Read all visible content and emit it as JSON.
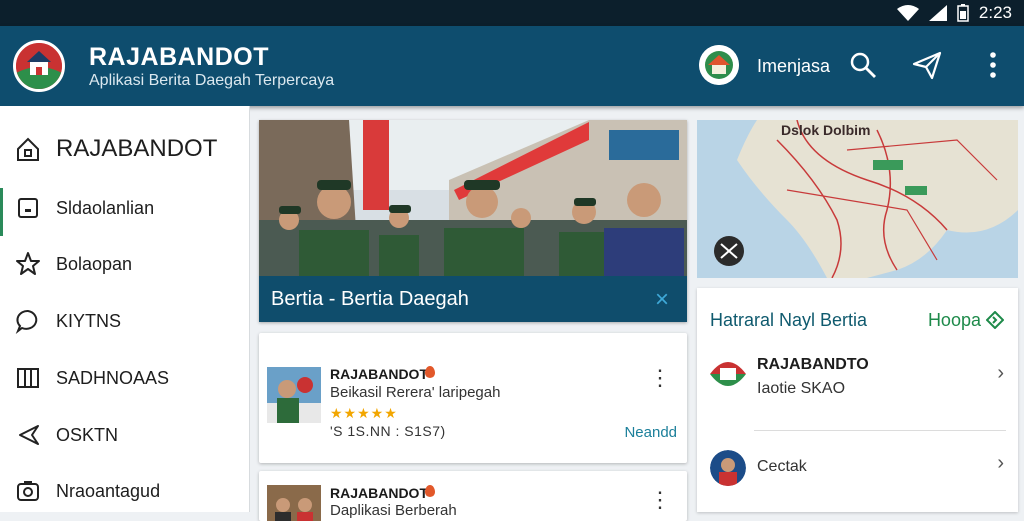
{
  "status": {
    "time": "2:23"
  },
  "appbar": {
    "title": "RAJABANDOT",
    "subtitle": "Aplikasi Berita Daegah Terpercaya",
    "user_name": "Imenjasa",
    "icons": [
      "search-icon",
      "send-icon",
      "more-vert-icon"
    ]
  },
  "sidebar": {
    "items": [
      {
        "label": "RAJABANDOT",
        "icon": "home-icon"
      },
      {
        "label": "Sldaolanlian",
        "icon": "square-icon"
      },
      {
        "label": "Bolaopan",
        "icon": "star-icon"
      },
      {
        "label": "KIYTNS",
        "icon": "chat-icon"
      },
      {
        "label": "SADHNOAAS",
        "icon": "columns-icon"
      },
      {
        "label": "OSKTN",
        "icon": "share-icon"
      },
      {
        "label": "Nraoantagud",
        "icon": "camera-icon"
      }
    ]
  },
  "hero": {
    "title": "Bertia - Bertia Daegah",
    "close": "×"
  },
  "cards": [
    {
      "title": "RAJABANDOT",
      "subtitle": "Beikasil Rerera' laripegah",
      "stars": "★★★★★",
      "meta": "'S 1S.NN : S1S7)",
      "link": "Neandd",
      "more": "⋮"
    },
    {
      "title": "RAJABANDOT",
      "subtitle": "Daplikasi Berberah",
      "more": "⋮"
    }
  ],
  "map": {
    "label": "Dslok Dolbim"
  },
  "panel": {
    "heading": "Hatraral Nayl Bertia",
    "link": "Hoopa",
    "items": [
      {
        "title": "RAJABANDTO",
        "subtitle": "Iaotie SKAO"
      },
      {
        "title": "",
        "subtitle": "Cectak"
      }
    ]
  },
  "colors": {
    "appbar": "#0e4d6e",
    "accent_green": "#1e8a4a",
    "hero_band": "#0f4d6c"
  }
}
